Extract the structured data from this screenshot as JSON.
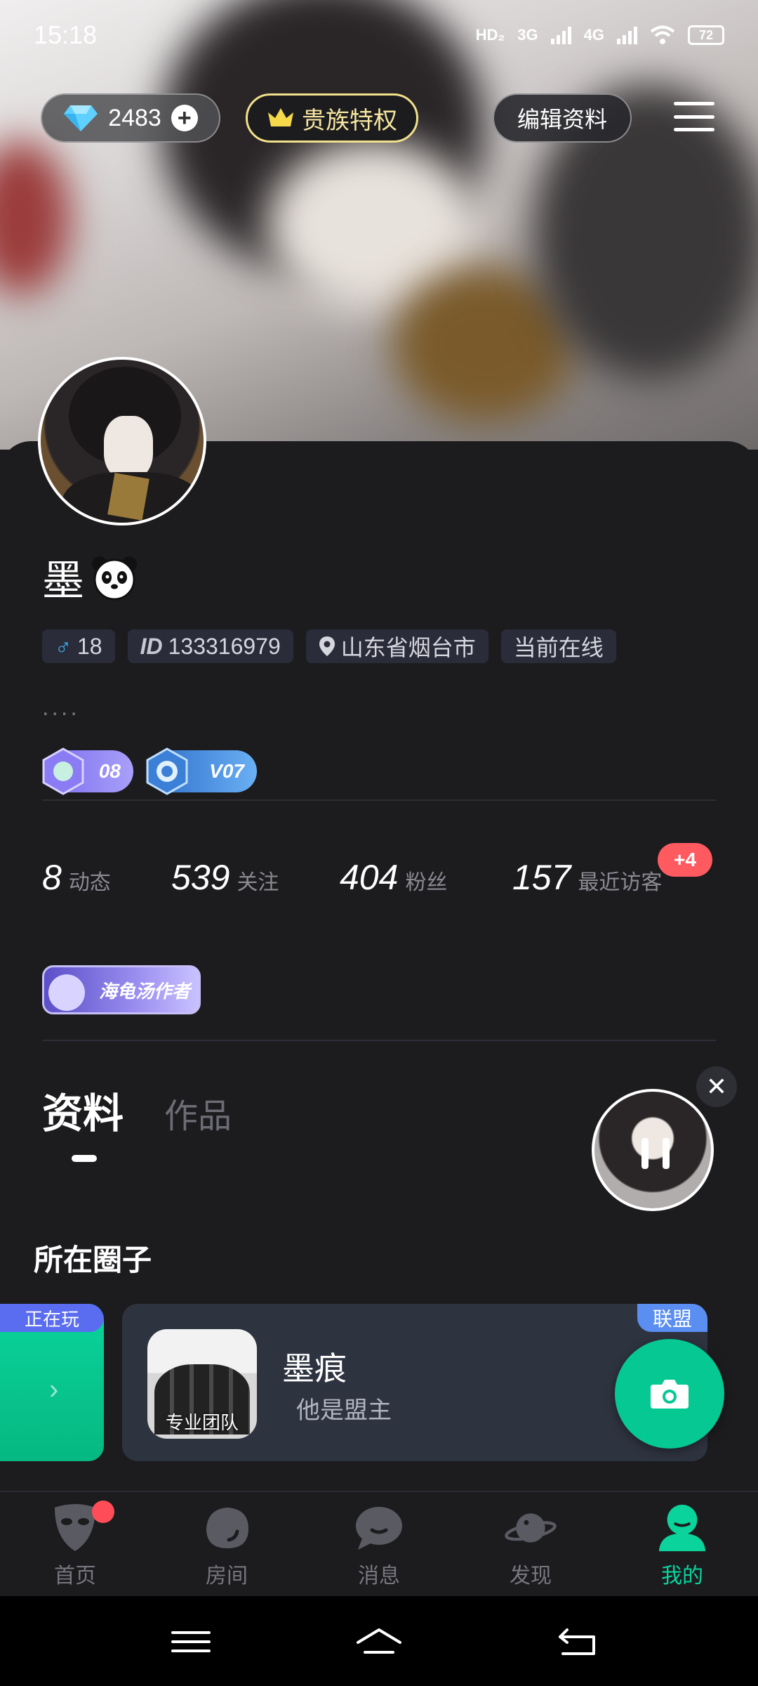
{
  "status_bar": {
    "time": "15:18",
    "network_hd": "HD₂",
    "net1": "3G",
    "net2": "4G",
    "battery": "72"
  },
  "header": {
    "diamond_count": "2483",
    "noble_label": "贵族特权",
    "edit_label": "编辑资料"
  },
  "profile": {
    "name": "墨",
    "gender_age": "18",
    "id_label": "ID",
    "id_value": "133316979",
    "location": "山东省烟台市",
    "online_status": "当前在线",
    "bio": "....",
    "level_badge": "08",
    "vip_badge": "V07",
    "medal_label": "海龟汤作者"
  },
  "stats": [
    {
      "value": "8",
      "label": "动态"
    },
    {
      "value": "539",
      "label": "关注"
    },
    {
      "value": "404",
      "label": "粉丝"
    },
    {
      "value": "157",
      "label": "最近访客"
    }
  ],
  "visitor_bubble": "+4",
  "tabs": {
    "active": "资料",
    "other": "作品"
  },
  "circles": {
    "section_title": "所在圈子",
    "playing_label": "正在玩",
    "card": {
      "tag": "联盟",
      "thumb_caption": "专业团队",
      "name": "墨痕",
      "role": "他是盟主"
    }
  },
  "nav": [
    {
      "label": "首页",
      "icon": "mask-icon"
    },
    {
      "label": "房间",
      "icon": "room-icon"
    },
    {
      "label": "消息",
      "icon": "chat-bubble-icon"
    },
    {
      "label": "发现",
      "icon": "planet-icon"
    },
    {
      "label": "我的",
      "icon": "profile-icon"
    }
  ],
  "colors": {
    "accent": "#0ad49c",
    "card_bg": "#1c1c1f",
    "badge_red": "#ff5a5f",
    "noble_gold": "#f2e08a"
  }
}
